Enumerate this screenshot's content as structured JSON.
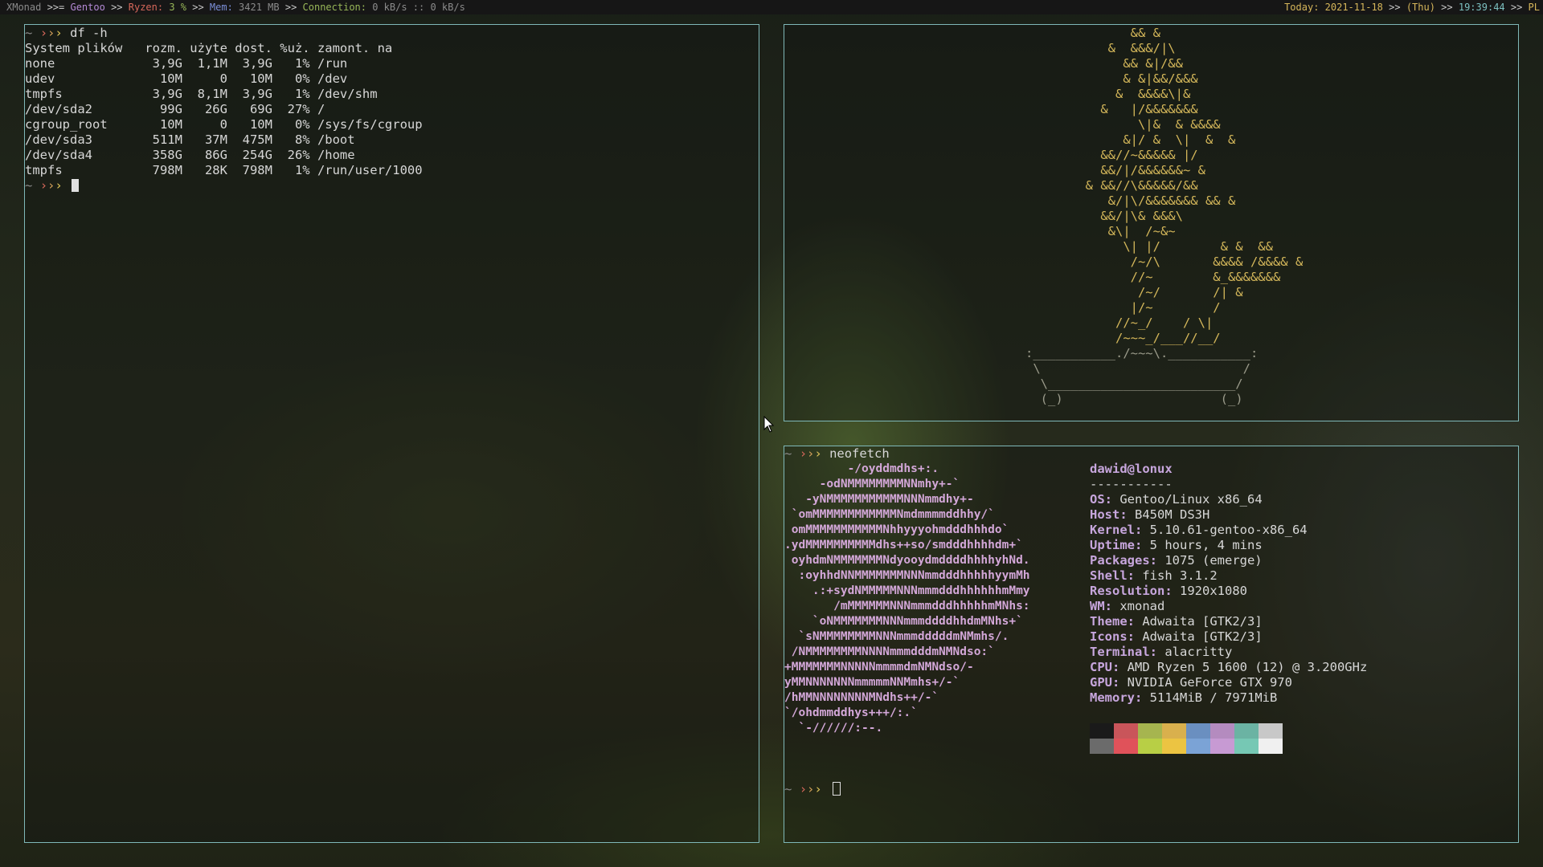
{
  "statusbar": {
    "wm": "XMonad",
    "sep1": " >>= ",
    "distro": "Gentoo",
    "sep2": " >> ",
    "cpu_label": "Ryzen: ",
    "cpu_value": "3 %",
    "sep3": " >> ",
    "mem_label": "Mem: ",
    "mem_value": "3421 MB",
    "sep4": " >> ",
    "net_label": "Connection: ",
    "net_value": "0 kB/s :: 0 kB/s",
    "today_label": "Today: ",
    "date": "2021-11-18",
    "sep5": " >> ",
    "weekday": "(Thu)",
    "sep6": " >> ",
    "time": "19:39:44",
    "sep7": " >> ",
    "lang": "PL",
    "colors": {
      "bg": "#161616",
      "grey": "#8b8b8b",
      "purple": "#b58ad7",
      "red": "#d6675a",
      "blue": "#7b8fd8",
      "green": "#98b758",
      "yellow": "#d6b65a"
    }
  },
  "prompt": {
    "tilde": "~",
    "a1": "›",
    "a2": "›",
    "a3": "›"
  },
  "terminal_df": {
    "command": "df -h",
    "lines": [
      "System plików   rozm. użyte dost. %uż. zamont. na",
      "none             3,9G  1,1M  3,9G   1% /run",
      "udev              10M     0   10M   0% /dev",
      "tmpfs            3,9G  8,1M  3,9G   1% /dev/shm",
      "/dev/sda2         99G   26G   69G  27% /",
      "cgroup_root       10M     0   10M   0% /sys/fs/cgroup",
      "/dev/sda3        511M   37M  475M   8% /boot",
      "/dev/sda4        358G   86G  254G  26% /home",
      "tmpfs            798M   28K  798M   1% /run/user/1000"
    ]
  },
  "terminal_tree": {
    "art": [
      "              && &",
      "           &  &&&/|\\",
      "             && &|/&&",
      "             & &|&&/&&&",
      "            &  &&&&\\|&",
      "          &   |/&&&&&&&",
      "               \\|&  & &&&&",
      "             &|/ &  \\|  &  &",
      "          &&//~&&&&& |/",
      "          &&/|/&&&&&&~ &",
      "        & &&//\\&&&&&/&&",
      "           &/|\\/&&&&&&& && &",
      "          &&/|\\& &&&\\",
      "           &\\|  /~&~",
      "             \\| |/        & &  &&",
      "              /~/\\       &&&& /&&&& &",
      "              //~        &_&&&&&&&",
      "               /~/       /| &",
      "              |/~        /",
      "            //~_/    / \\|",
      "            /~~~_/___//__/"
    ],
    "pot": [
      ":___________./~~~\\.___________:",
      " \\                           /",
      "  \\_________________________/",
      "  (_)                     (_)"
    ]
  },
  "terminal_neofetch": {
    "command": "neofetch",
    "logo": [
      "         -/oyddmdhs+:.",
      "     -odNMMMMMMMMNNmhy+-`",
      "   -yNMMMMMMMMMMMNNNmmdhy+-",
      " `omMMMMMMMMMMMMNmdmmmmddhhy/`",
      " omMMMMMMMMMMMNhhyyyohmdddhhhdo`",
      ".ydMMMMMMMMMMdhs++so/smdddhhhhdm+`",
      " oyhdmNMMMMMMMNdyooydmddddhhhhyhNd.",
      "  :oyhhdNNMMMMMMMNNNmmdddhhhhhyymMh",
      "    .:+sydNMMMMMNNNmmmdddhhhhhhmMmy",
      "       /mMMMMMMNNNmmmdddhhhhhmMNhs:",
      "    `oNMMMMMMMNNNmmmddddhhdmMNhs+`",
      "  `sNMMMMMMMMNNNmmmdddddmNMmhs/.",
      " /NMMMMMMMMNNNNmmmdddmNMNdso:`",
      "+MMMMMMMNNNNNmmmmdmNMNdso/-",
      "yMMNNNNNNNmmmmmNNMmhs+/-`",
      "/hMMNNNNNNNNMNdhs++/-`",
      "`/ohdmmddhys+++/:.`",
      "  `-//////:--."
    ],
    "user": "dawid@lonux",
    "separator": "-----------",
    "info": [
      {
        "key": "OS",
        "value": "Gentoo/Linux x86_64"
      },
      {
        "key": "Host",
        "value": "B450M DS3H"
      },
      {
        "key": "Kernel",
        "value": "5.10.61-gentoo-x86_64"
      },
      {
        "key": "Uptime",
        "value": "5 hours, 4 mins"
      },
      {
        "key": "Packages",
        "value": "1075 (emerge)"
      },
      {
        "key": "Shell",
        "value": "fish 3.1.2"
      },
      {
        "key": "Resolution",
        "value": "1920x1080"
      },
      {
        "key": "WM",
        "value": "xmonad"
      },
      {
        "key": "Theme",
        "value": "Adwaita [GTK2/3]"
      },
      {
        "key": "Icons",
        "value": "Adwaita [GTK2/3]"
      },
      {
        "key": "Terminal",
        "value": "alacritty"
      },
      {
        "key": "CPU",
        "value": "AMD Ryzen 5 1600 (12) @ 3.200GHz"
      },
      {
        "key": "GPU",
        "value": "NVIDIA GeForce GTX 970"
      },
      {
        "key": "Memory",
        "value": "5114MiB / 7971MiB"
      }
    ],
    "palette_top": [
      "#1a1a1a",
      "#c9555a",
      "#a6b54f",
      "#d9b04d",
      "#6a8fc0",
      "#b48bbf",
      "#6bb3a3",
      "#c8c8c8"
    ],
    "palette_bottom": [
      "#6b6b6b",
      "#e0525a",
      "#b8cf45",
      "#ecc442",
      "#7ba3d6",
      "#c79ad3",
      "#76c8b4",
      "#f0f0f0"
    ]
  }
}
